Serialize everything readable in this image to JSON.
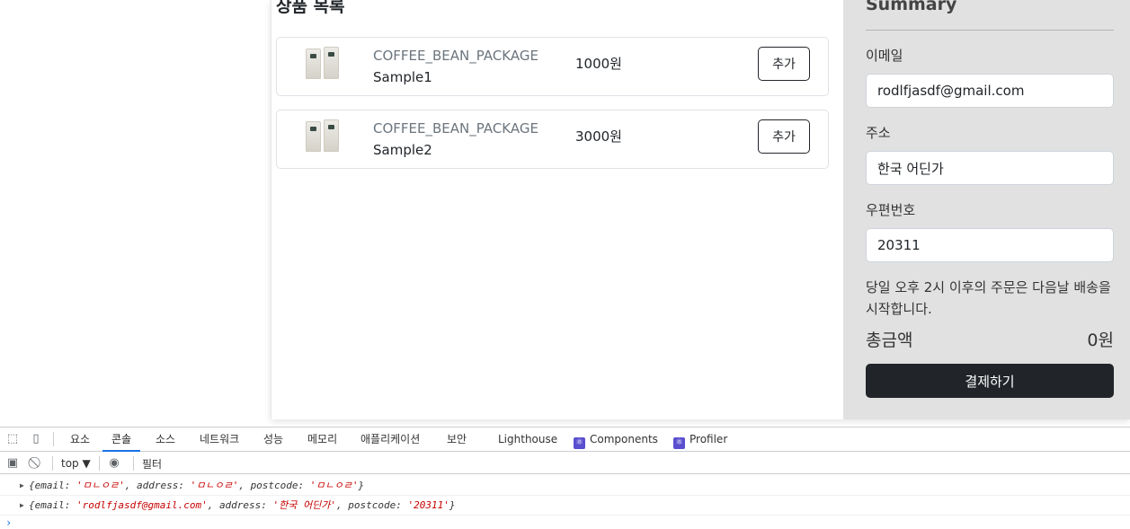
{
  "products": {
    "title": "상품 목록",
    "items": [
      {
        "category": "COFFEE_BEAN_PACKAGE",
        "name": "Sample1",
        "price": "1000원",
        "add_label": "추가"
      },
      {
        "category": "COFFEE_BEAN_PACKAGE",
        "name": "Sample2",
        "price": "3000원",
        "add_label": "추가"
      }
    ]
  },
  "summary": {
    "title": "Summary",
    "email_label": "이메일",
    "email_value": "rodlfjasdf@gmail.com",
    "address_label": "주소",
    "address_value": "한국 어딘가",
    "postcode_label": "우편번호",
    "postcode_value": "20311",
    "notice": "당일 오후 2시 이후의 주문은 다음날 배송을 시작합니다.",
    "total_label": "총금액",
    "total_value": "0원",
    "checkout_label": "결제하기"
  },
  "devtools": {
    "tabs": [
      "요소",
      "콘솔",
      "소스",
      "네트워크",
      "성능",
      "메모리",
      "애플리케이션",
      "보안",
      "Lighthouse",
      "Components",
      "Profiler"
    ],
    "active_tab": "콘솔",
    "context": "top ▼",
    "filter_placeholder": "필터",
    "console_logs": [
      {
        "email": "ㅁㄴㅇㄹ",
        "address": "ㅁㄴㅇㄹ",
        "postcode": "ㅁㄴㅇㄹ"
      },
      {
        "email": "rodlfjasdf@gmail.com",
        "address": "한국 어딘가",
        "postcode": "20311"
      }
    ],
    "prompt": "›"
  },
  "colors": {
    "summary_bg": "#e1e1e1",
    "checkout_bg": "#212529",
    "active_tab_underline": "#1a73e8",
    "string_value": "#c80000"
  }
}
